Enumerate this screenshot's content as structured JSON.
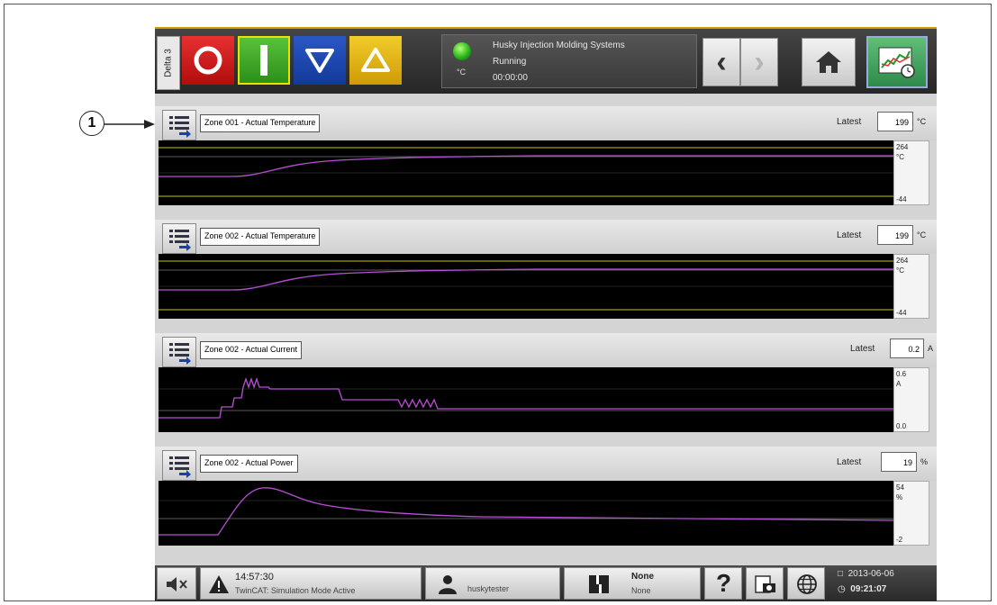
{
  "callout": {
    "number": "1"
  },
  "header": {
    "station_tab": "Delta 3",
    "buttons": {
      "stop": "stop-icon",
      "start": "start-icon",
      "down": "down-triangle-icon",
      "up": "up-triangle-icon"
    },
    "status": {
      "title": "Husky Injection Molding Systems",
      "state": "Running",
      "timer": "00:00:00",
      "unit": "°C",
      "led_color": "#29b61a"
    }
  },
  "panels": [
    {
      "label": "Zone 001 - Actual Temperature",
      "latest_label": "Latest",
      "latest_value": "199",
      "unit": "°C",
      "scale_max": "264",
      "scale_unit": "°C",
      "scale_min": "-44"
    },
    {
      "label": "Zone 002 - Actual Temperature",
      "latest_label": "Latest",
      "latest_value": "199",
      "unit": "°C",
      "scale_max": "264",
      "scale_unit": "°C",
      "scale_min": "-44"
    },
    {
      "label": "Zone 002 - Actual Current",
      "latest_label": "Latest",
      "latest_value": "0.2",
      "unit": "A",
      "scale_max": "0.6",
      "scale_unit": "A",
      "scale_min": "0.0"
    },
    {
      "label": "Zone 002 - Actual Power",
      "latest_label": "Latest",
      "latest_value": "19",
      "unit": "%",
      "scale_max": "54",
      "scale_unit": "%",
      "scale_min": "-2"
    }
  ],
  "footer": {
    "alarm_time": "14:57:30",
    "alarm_text": "TwinCAT: Simulation Mode Active",
    "user": "huskytester",
    "mold_line1": "None",
    "mold_line2": "None",
    "date": "2013-06-06",
    "time": "09:21:07"
  },
  "colors": {
    "trace": "#b84fd6",
    "limit": "#c8c800",
    "plot_bg": "#000000"
  }
}
